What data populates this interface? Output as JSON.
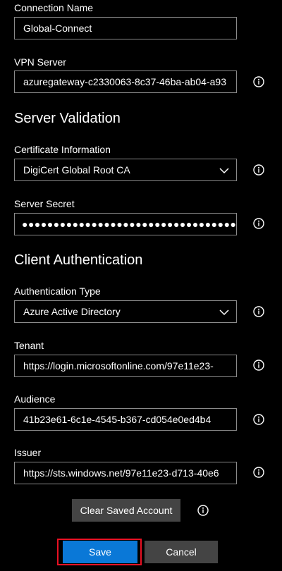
{
  "connection": {
    "name_label": "Connection Name",
    "name_value": "Global-Connect",
    "server_label": "VPN Server",
    "server_value": "azuregateway-c2330063-8c37-46ba-ab04-a93"
  },
  "server_validation": {
    "heading": "Server Validation",
    "certificate_label": "Certificate Information",
    "certificate_value": "DigiCert Global Root CA",
    "secret_label": "Server Secret",
    "secret_value": "●●●●●●●●●●●●●●●●●●●●●●●●●●●●●●●●●●●●"
  },
  "client_auth": {
    "heading": "Client Authentication",
    "auth_type_label": "Authentication Type",
    "auth_type_value": "Azure Active Directory",
    "tenant_label": "Tenant",
    "tenant_value": "https://login.microsoftonline.com/97e11e23-",
    "audience_label": "Audience",
    "audience_value": "41b23e61-6c1e-4545-b367-cd054e0ed4b4",
    "issuer_label": "Issuer",
    "issuer_value": "https://sts.windows.net/97e11e23-d713-40e6"
  },
  "actions": {
    "clear_label": "Clear Saved Account",
    "save_label": "Save",
    "cancel_label": "Cancel"
  },
  "colors": {
    "background": "#000000",
    "field_border": "#8a8a8a",
    "button_gray": "#444444",
    "save_accent": "#0a78d7",
    "focus_highlight": "#e81123"
  },
  "icons": {
    "info": "info-icon",
    "dropdown": "chevron-down-icon"
  }
}
